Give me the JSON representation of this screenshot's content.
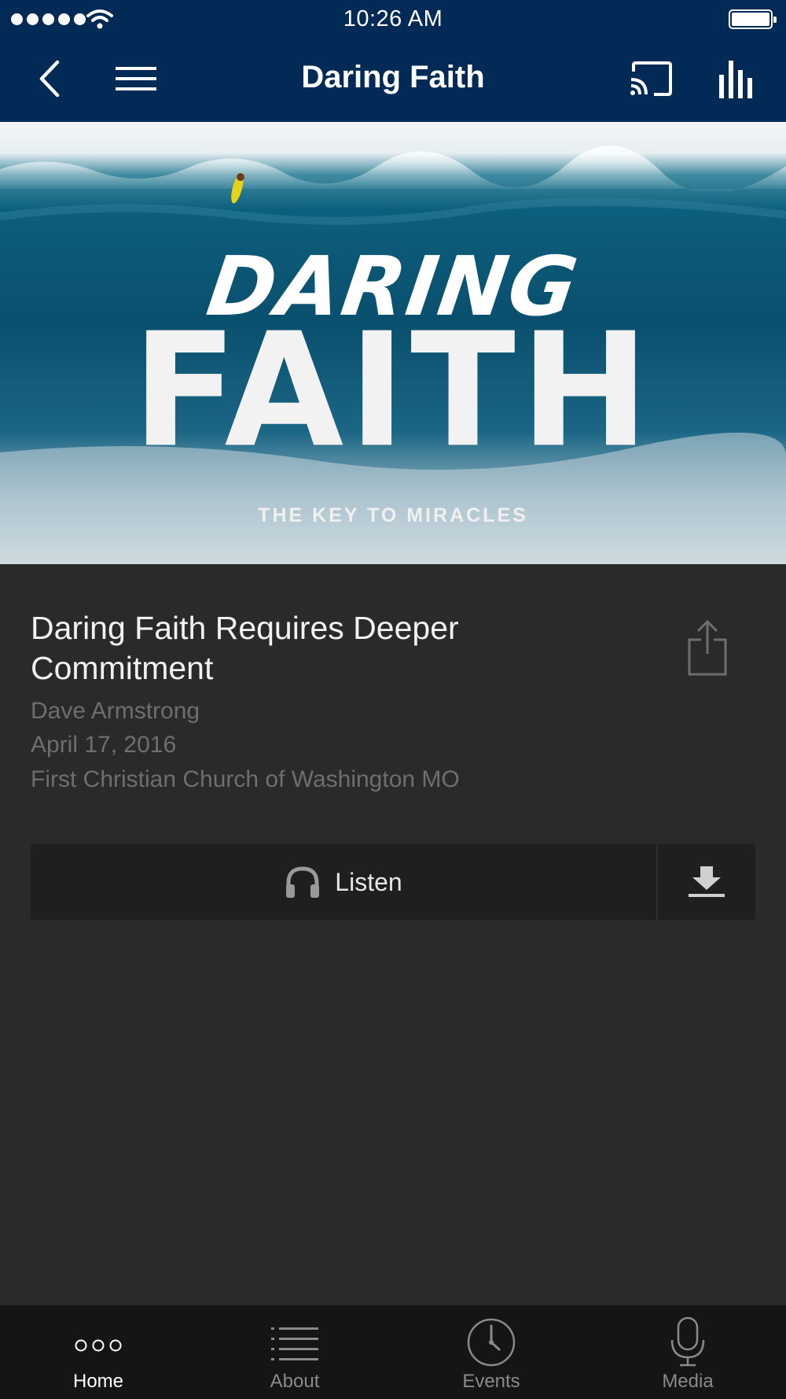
{
  "status_bar": {
    "time": "10:26 AM"
  },
  "nav": {
    "title": "Daring Faith"
  },
  "hero": {
    "line1": "DARING",
    "line2": "FAITH",
    "subtitle": "THE KEY TO MIRACLES"
  },
  "sermon": {
    "title": "Daring Faith Requires Deeper Commitment",
    "speaker": "Dave Armstrong",
    "date": "April 17, 2016",
    "church": "First Christian Church of Washington MO"
  },
  "actions": {
    "listen_label": "Listen"
  },
  "tabs": [
    {
      "label": "Home",
      "icon": "dots-icon",
      "active": true
    },
    {
      "label": "About",
      "icon": "list-icon",
      "active": false
    },
    {
      "label": "Events",
      "icon": "clock-icon",
      "active": false
    },
    {
      "label": "Media",
      "icon": "microphone-icon",
      "active": false
    }
  ],
  "colors": {
    "nav_background": "#022a57",
    "content_background": "#2a2a2a",
    "tabbar_background": "#151515"
  }
}
